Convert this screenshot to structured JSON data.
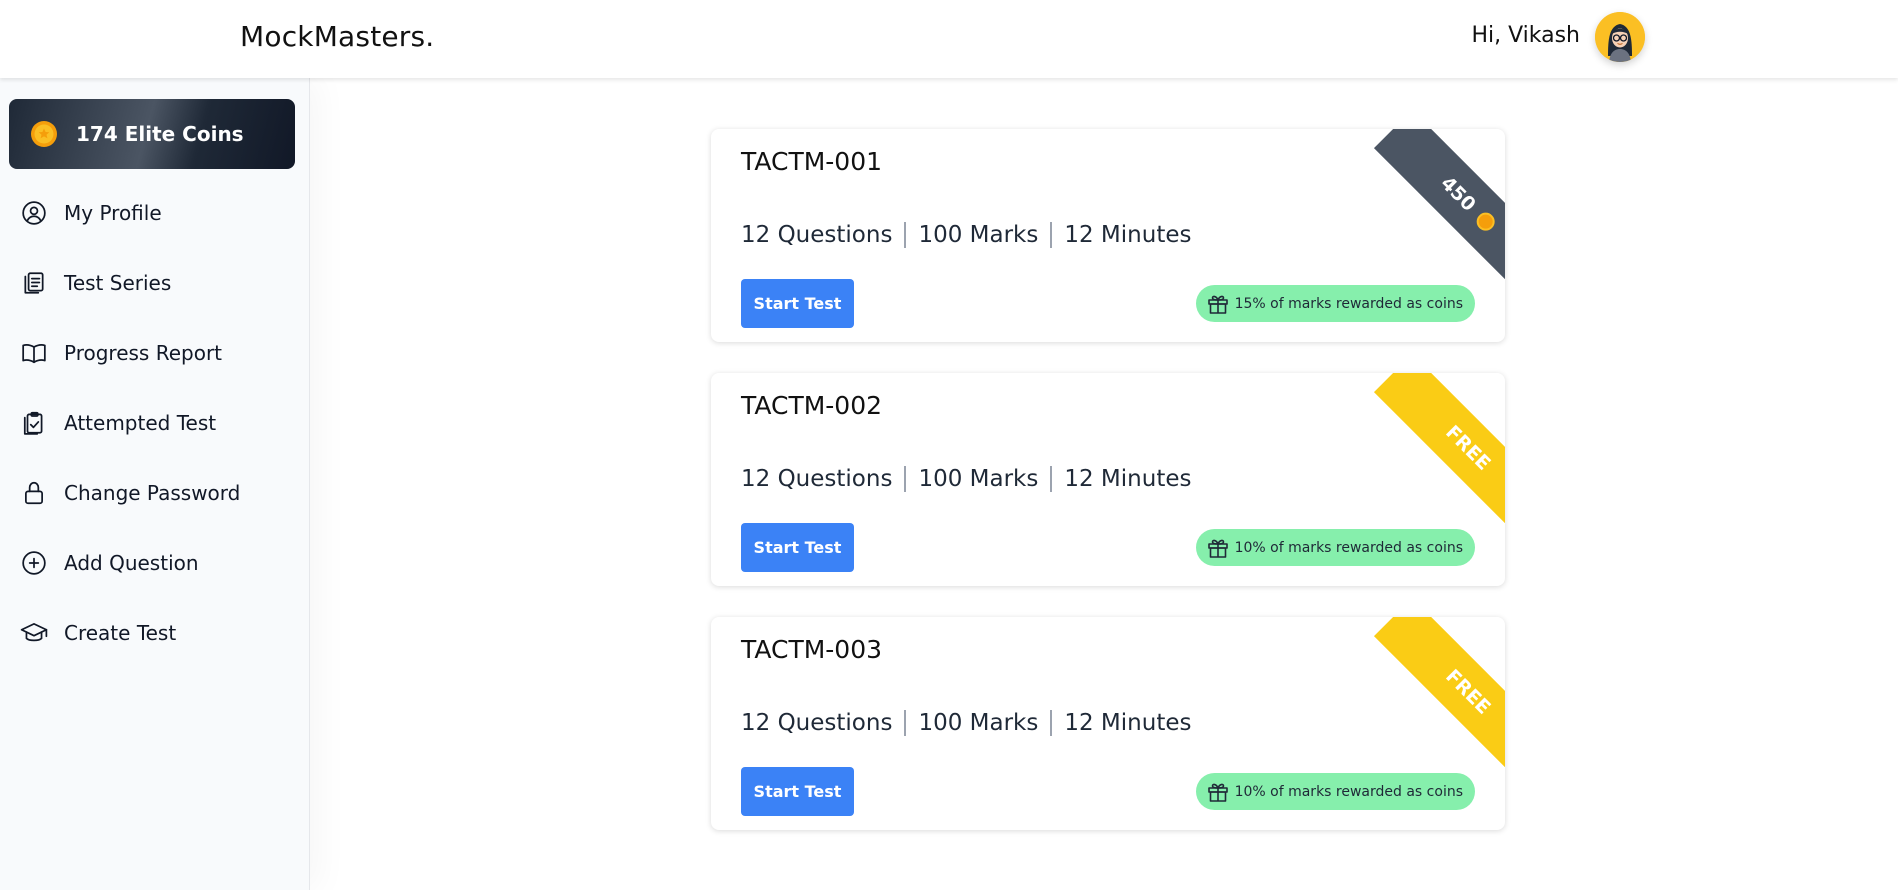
{
  "header": {
    "brand": "MockMasters.",
    "greeting": "Hi, Vikash"
  },
  "sidebar": {
    "coins_label": "174 Elite Coins",
    "items": [
      {
        "label": "My Profile",
        "icon": "user-circle-icon"
      },
      {
        "label": "Test Series",
        "icon": "clipboard-list-icon"
      },
      {
        "label": "Progress Report",
        "icon": "book-open-icon"
      },
      {
        "label": "Attempted Test",
        "icon": "clipboard-check-icon"
      },
      {
        "label": "Change Password",
        "icon": "lock-icon"
      },
      {
        "label": "Add Question",
        "icon": "plus-circle-icon"
      },
      {
        "label": "Create Test",
        "icon": "graduation-cap-icon"
      }
    ]
  },
  "colors": {
    "primary_button": "#3b82f6",
    "reward_badge": "#86efac",
    "ribbon_paid": "#4b5563",
    "ribbon_free": "#facc15",
    "coin": "#f59e0b"
  },
  "tests": [
    {
      "title": "TACTM-001",
      "questions": "12 Questions",
      "marks": "100 Marks",
      "minutes": "12 Minutes",
      "button": "Start Test",
      "reward": "15% of marks rewarded as coins",
      "ribbon": "450"
    },
    {
      "title": "TACTM-002",
      "questions": "12 Questions",
      "marks": "100 Marks",
      "minutes": "12 Minutes",
      "button": "Start Test",
      "reward": "10% of marks rewarded as coins",
      "ribbon": "FREE"
    },
    {
      "title": "TACTM-003",
      "questions": "12 Questions",
      "marks": "100 Marks",
      "minutes": "12 Minutes",
      "button": "Start Test",
      "reward": "10% of marks rewarded as coins",
      "ribbon": "FREE"
    }
  ]
}
